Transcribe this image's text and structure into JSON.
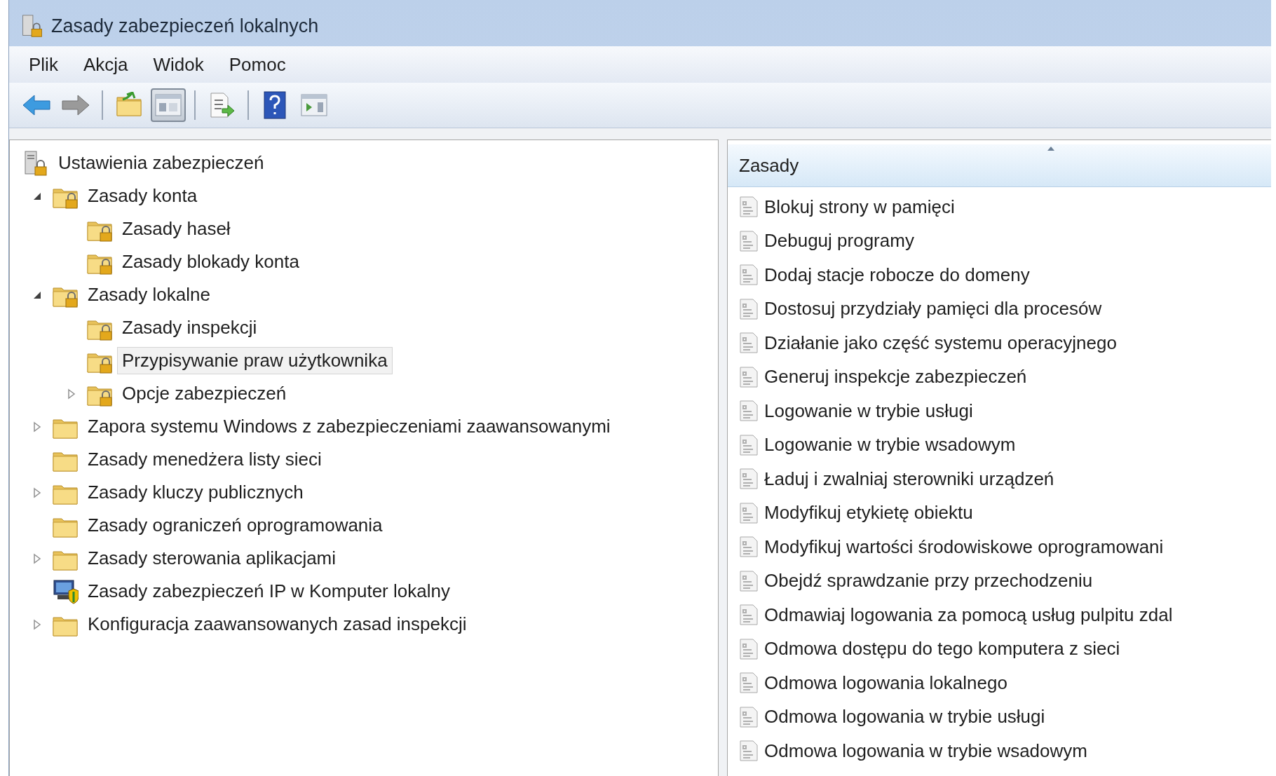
{
  "window": {
    "title": "Zasady zabezpieczeń lokalnych"
  },
  "menu": [
    "Plik",
    "Akcja",
    "Widok",
    "Pomoc"
  ],
  "toolbar": {
    "groups": [
      [
        {
          "kind": "back",
          "pressed": false
        },
        {
          "kind": "forward",
          "pressed": false
        }
      ],
      [
        {
          "kind": "up",
          "pressed": false
        },
        {
          "kind": "tree",
          "pressed": true
        }
      ],
      [
        {
          "kind": "export",
          "pressed": false
        }
      ],
      [
        {
          "kind": "help",
          "pressed": false
        },
        {
          "kind": "panel",
          "pressed": false
        }
      ]
    ]
  },
  "tree": [
    {
      "label": "Ustawienia zabezpieczeń",
      "kind": "root",
      "selected": false,
      "children": [
        {
          "label": "Zasady konta",
          "kind": "folder-lock",
          "expanded": true,
          "selected": false,
          "children": [
            {
              "label": "Zasady haseł",
              "kind": "folder-lock",
              "selected": false
            },
            {
              "label": "Zasady blokady konta",
              "kind": "folder-lock",
              "selected": false
            }
          ]
        },
        {
          "label": "Zasady lokalne",
          "kind": "folder-lock",
          "expanded": true,
          "selected": false,
          "children": [
            {
              "label": "Zasady inspekcji",
              "kind": "folder-lock",
              "selected": false
            },
            {
              "label": "Przypisywanie praw użytkownika",
              "kind": "folder-lock",
              "selected": true
            },
            {
              "label": "Opcje zabezpieczeń",
              "kind": "folder-lock",
              "expanded": false,
              "selected": false
            }
          ]
        },
        {
          "label": "Zapora systemu Windows z zabezpieczeniami zaawansowanymi",
          "kind": "folder",
          "expanded": false,
          "selected": false
        },
        {
          "label": "Zasady menedżera listy sieci",
          "kind": "folder",
          "selected": false
        },
        {
          "label": "Zasady kluczy publicznych",
          "kind": "folder",
          "expanded": false,
          "selected": false
        },
        {
          "label": "Zasady ograniczeń oprogramowania",
          "kind": "folder",
          "selected": false
        },
        {
          "label": "Zasady sterowania aplikacjami",
          "kind": "folder",
          "expanded": false,
          "selected": false
        },
        {
          "label": "Zasady zabezpieczeń IP w Komputer lokalny",
          "kind": "computer",
          "selected": false
        },
        {
          "label": "Konfiguracja zaawansowanych zasad inspekcji",
          "kind": "folder",
          "expanded": false,
          "selected": false
        }
      ]
    }
  ],
  "list": {
    "column": {
      "label": "Zasady",
      "sort_ascending": true
    },
    "rows": [
      "Blokuj strony w pamięci",
      "Debuguj programy",
      "Dodaj stacje robocze do domeny",
      "Dostosuj przydziały pamięci dla procesów",
      "Działanie jako część systemu operacyjnego",
      "Generuj inspekcje zabezpieczeń",
      "Logowanie w trybie usługi",
      "Logowanie w trybie wsadowym",
      "Ładuj i zwalniaj sterowniki urządzeń",
      "Modyfikuj etykietę obiektu",
      "Modyfikuj wartości środowiskowe oprogramowani",
      "Obejdź sprawdzanie przy przechodzeniu",
      "Odmawiaj logowania za pomocą usług pulpitu zdal",
      "Odmowa dostępu do tego komputera z sieci",
      "Odmowa logowania lokalnego",
      "Odmowa logowania w trybie usługi",
      "Odmowa logowania w trybie wsadowym"
    ]
  }
}
